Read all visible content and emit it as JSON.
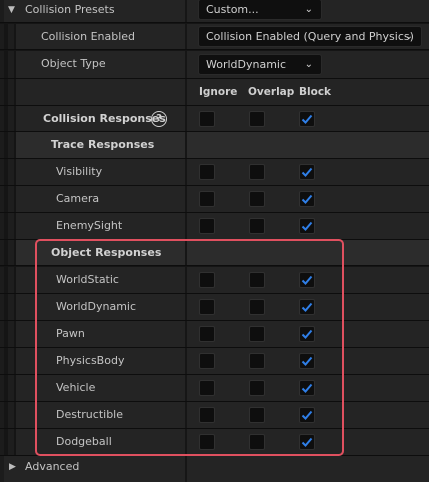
{
  "presets": {
    "label": "Collision Presets",
    "value": "Custom..."
  },
  "enabled": {
    "label": "Collision Enabled",
    "value": "Collision Enabled (Query and Physics)"
  },
  "object_type": {
    "label": "Object Type",
    "value": "WorldDynamic"
  },
  "columns": {
    "ignore": "Ignore",
    "overlap": "Overlap",
    "block": "Block"
  },
  "responses_label": "Collision Responses",
  "help_glyph": "?",
  "trace": {
    "title": "Trace Responses",
    "items": [
      {
        "label": "Visibility",
        "ignore": false,
        "overlap": false,
        "block": true
      },
      {
        "label": "Camera",
        "ignore": false,
        "overlap": false,
        "block": true
      },
      {
        "label": "EnemySight",
        "ignore": false,
        "overlap": false,
        "block": true
      }
    ]
  },
  "object": {
    "title": "Object Responses",
    "items": [
      {
        "label": "WorldStatic",
        "ignore": false,
        "overlap": false,
        "block": true
      },
      {
        "label": "WorldDynamic",
        "ignore": false,
        "overlap": false,
        "block": true
      },
      {
        "label": "Pawn",
        "ignore": false,
        "overlap": false,
        "block": true
      },
      {
        "label": "PhysicsBody",
        "ignore": false,
        "overlap": false,
        "block": true
      },
      {
        "label": "Vehicle",
        "ignore": false,
        "overlap": false,
        "block": true
      },
      {
        "label": "Destructible",
        "ignore": false,
        "overlap": false,
        "block": true
      },
      {
        "label": "Dodgeball",
        "ignore": false,
        "overlap": false,
        "block": true
      }
    ]
  },
  "advanced_label": "Advanced",
  "colors": {
    "check": "#2f7fe8",
    "highlight": "#e0505f"
  }
}
